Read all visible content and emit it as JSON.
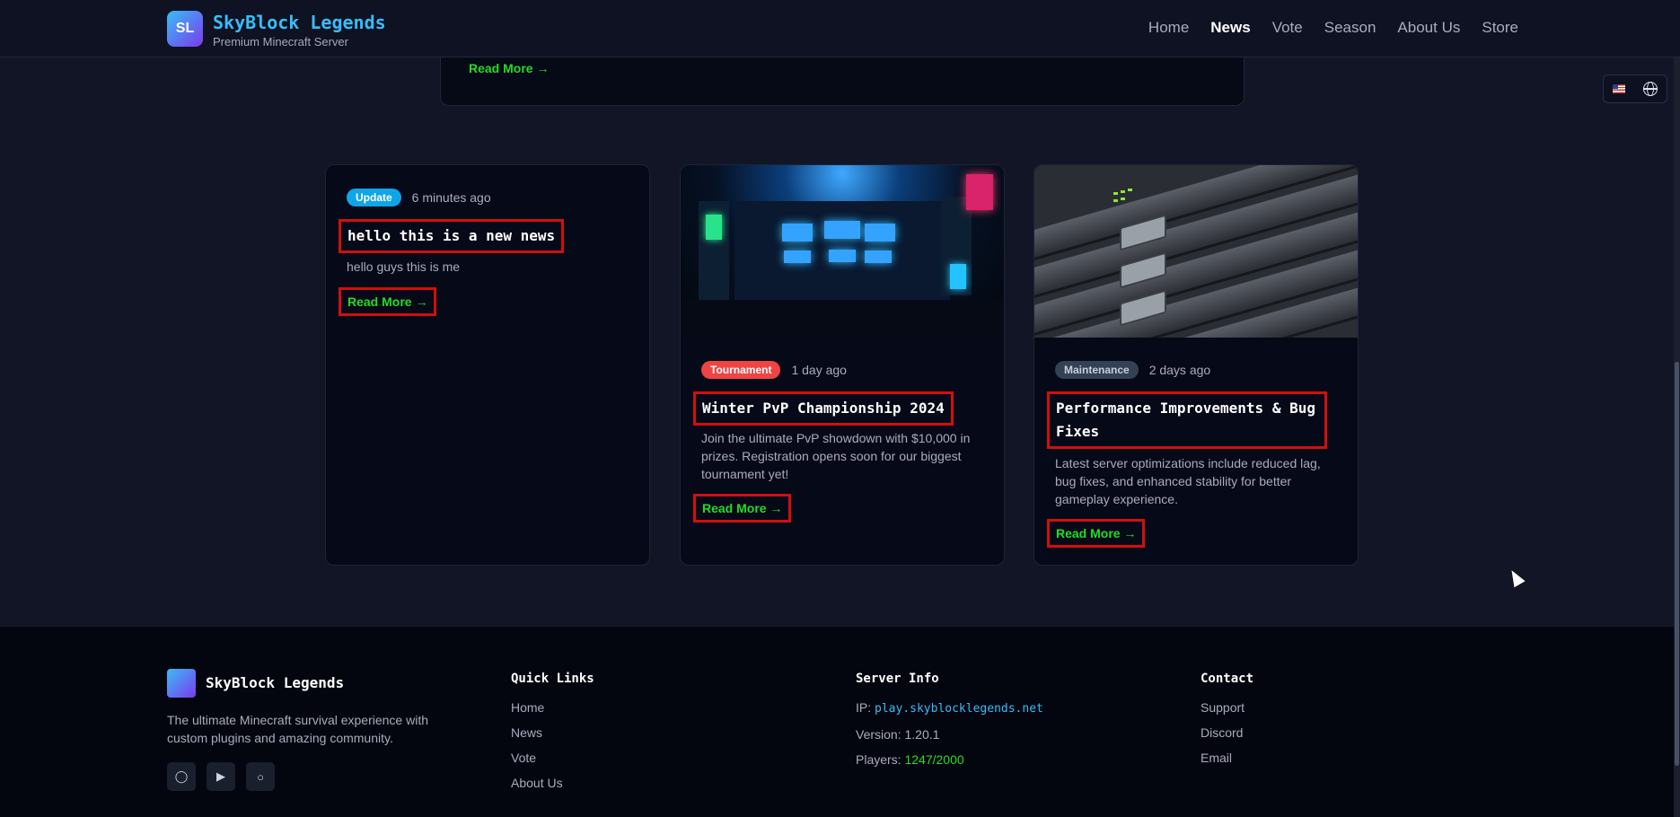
{
  "header": {
    "logo_initials": "SL",
    "brand": "SkyBlock Legends",
    "subtitle": "Premium Minecraft Server",
    "nav": [
      "Home",
      "News",
      "Vote",
      "Season",
      "About Us",
      "Store"
    ],
    "active_nav": "News"
  },
  "featured": {
    "read_more": "Read More →"
  },
  "cards": [
    {
      "badge": "Update",
      "badge_color": "#0ea5e9",
      "time": "6 minutes ago",
      "title": "hello this is a new news",
      "desc": "hello guys this is me",
      "read_more": "Read More →"
    },
    {
      "badge": "Tournament",
      "badge_color": "#ef4444",
      "time": "1 day ago",
      "title": "Winter PvP Championship 2024",
      "desc": "Join the ultimate PvP showdown with $10,000 in prizes. Registration opens soon for our biggest tournament yet!",
      "read_more": "Read More →"
    },
    {
      "badge": "Maintenance",
      "badge_color": "#334155",
      "time": "2 days ago",
      "title": "Performance Improvements & Bug Fixes",
      "desc": "Latest server optimizations include reduced lag, bug fixes, and enhanced stability for better gameplay experience.",
      "read_more": "Read More →"
    }
  ],
  "footer": {
    "brand": "SkyBlock Legends",
    "about": "The ultimate Minecraft survival experience with custom plugins and amazing community.",
    "quick_links": {
      "heading": "Quick Links",
      "items": [
        "Home",
        "News",
        "Vote",
        "About Us"
      ]
    },
    "server_info": {
      "heading": "Server Info",
      "ip_label": "IP:",
      "ip": "play.skyblocklegends.net",
      "version": "Version: 1.20.1",
      "players_label": "Players:",
      "players": "1247/2000"
    },
    "contact": {
      "heading": "Contact",
      "items": [
        "Support",
        "Discord",
        "Email"
      ]
    }
  },
  "colors": {
    "accent": "#38bdf8",
    "link_green": "#22dd22",
    "highlight_red": "#d10f0f"
  },
  "icons": [
    "flag-us-icon",
    "globe-icon",
    "chat-icon",
    "youtube-icon",
    "github-icon"
  ]
}
